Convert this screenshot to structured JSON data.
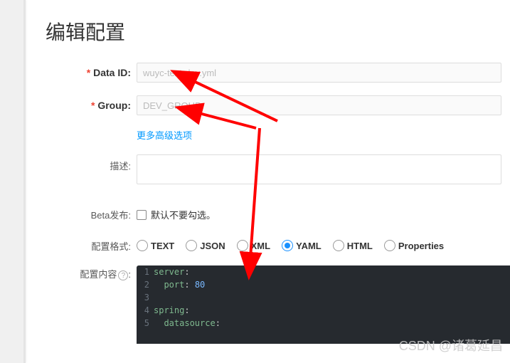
{
  "title": "编辑配置",
  "labels": {
    "dataId": "Data ID:",
    "group": "Group:",
    "moreAdvanced": "更多高级选项",
    "description": "描述:",
    "beta": "Beta发布:",
    "betaCheckbox": "默认不要勾选。",
    "format": "配置格式:",
    "content": "配置内容"
  },
  "fields": {
    "dataId": "wuyc-text-dev.yml",
    "group": "DEV_GROUP"
  },
  "formats": {
    "options": [
      "TEXT",
      "JSON",
      "XML",
      "YAML",
      "HTML",
      "Properties"
    ],
    "selected": "YAML"
  },
  "code": [
    {
      "n": 1,
      "segs": [
        {
          "t": "server",
          "c": "kw"
        },
        {
          "t": ":"
        }
      ]
    },
    {
      "n": 2,
      "segs": [
        {
          "t": "  "
        },
        {
          "t": "port",
          "c": "kw"
        },
        {
          "t": ": "
        },
        {
          "t": "80",
          "c": "num"
        }
      ]
    },
    {
      "n": 3,
      "segs": [
        {
          "t": ""
        }
      ]
    },
    {
      "n": 4,
      "segs": [
        {
          "t": "spring",
          "c": "kw"
        },
        {
          "t": ":"
        }
      ]
    },
    {
      "n": 5,
      "segs": [
        {
          "t": "  "
        },
        {
          "t": "datasource",
          "c": "kw"
        },
        {
          "t": ":"
        }
      ]
    }
  ],
  "watermark": "CSDN @诸葛延昌"
}
